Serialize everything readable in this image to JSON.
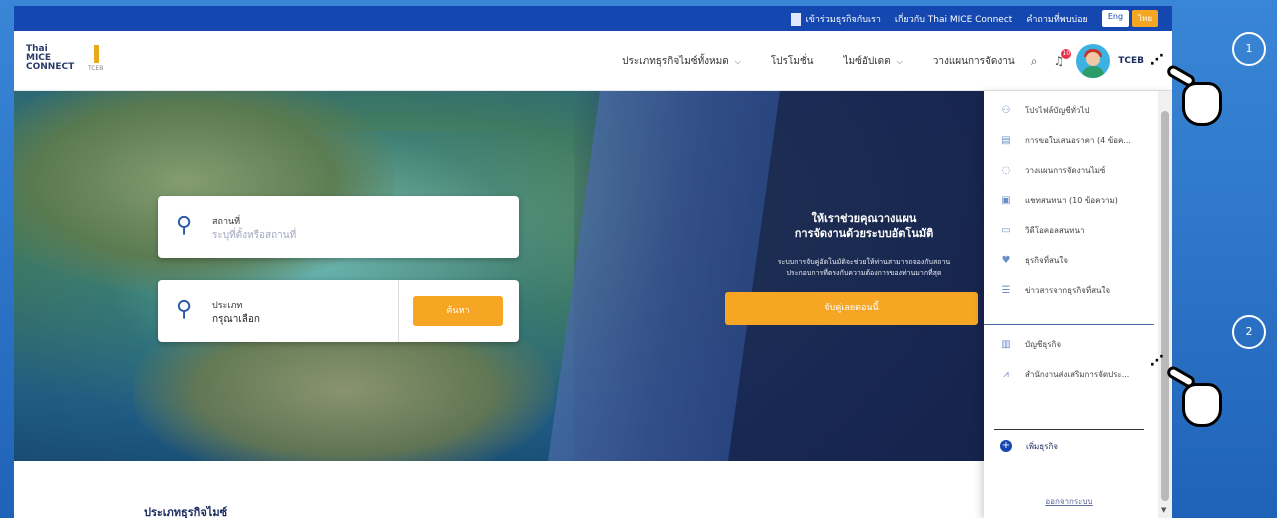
{
  "topbar": {
    "join_label": "เข้าร่วมธุรกิจกับเรา",
    "about_label": "เกี่ยวกับ Thai MICE Connect",
    "faq_label": "คำถามที่พบบ่อย",
    "lang_en": "Eng",
    "lang_th": "ไทย"
  },
  "logo": {
    "text": "Thai MICE CONNECT",
    "tceb_label": "TCEB"
  },
  "nav": {
    "item1": "ประเภทธุรกิจไมซ์ทั้งหมด",
    "item2": "โปรโมชั่น",
    "item3": "ไมซ์อัปเดต",
    "item4": "วางแผนการจัดงาน",
    "notif_count": "10",
    "user_name": "TCEB"
  },
  "search": {
    "place_label": "สถานที่",
    "place_placeholder": "ระบุที่ตั้งหรือสถานที่",
    "type_label": "ประเภท",
    "type_value": "กรุณาเลือก",
    "search_button": "ค้นหา"
  },
  "promo": {
    "title_line1": "ให้เราช่วยคุณวางแผน",
    "title_line2": "การจัดงานด้วยระบบอัตโนมัติ",
    "desc_line1": "ระบบการจับคู่อัตโนมัติจะช่วยให้ท่านสามารถจองกับสถาน",
    "desc_line2": "ประกอบการที่ตรงกับความต้องการของท่านมากที่สุด",
    "button": "จับคู่เลยตอนนี้"
  },
  "section_title": "ประเภทธุรกิจไมซ์",
  "dropdown": {
    "items": [
      {
        "label": "โปรไฟล์บัญชีทั่วไป",
        "icon": "user-icon"
      },
      {
        "label": "การขอใบเสนอราคา (4 ข้อค...",
        "icon": "document-icon"
      },
      {
        "label": "วางแผนการจัดงานไมซ์",
        "icon": "plan-icon"
      },
      {
        "label": "แชทสนทนา (10 ข้อความ)",
        "icon": "chat-icon"
      },
      {
        "label": "วิดีโอคอลสนทนา",
        "icon": "video-icon"
      },
      {
        "label": "ธุรกิจที่สนใจ",
        "icon": "thumbs-up-icon"
      },
      {
        "label": "ข่าวสารจากธุรกิจที่สนใจ",
        "icon": "news-icon"
      },
      {
        "label": "บัญชีธุรกิจ",
        "icon": "building-icon"
      },
      {
        "label": "สำนักงานส่งเสริมการจัดประ...",
        "icon": "tceb-icon"
      }
    ],
    "add_business": "เพิ่มธุรกิจ",
    "logout": "ออกจากระบบ"
  },
  "steps": {
    "step1": "1",
    "step2": "2"
  },
  "colors": {
    "primary": "#1547b0",
    "accent": "#f6a623"
  }
}
